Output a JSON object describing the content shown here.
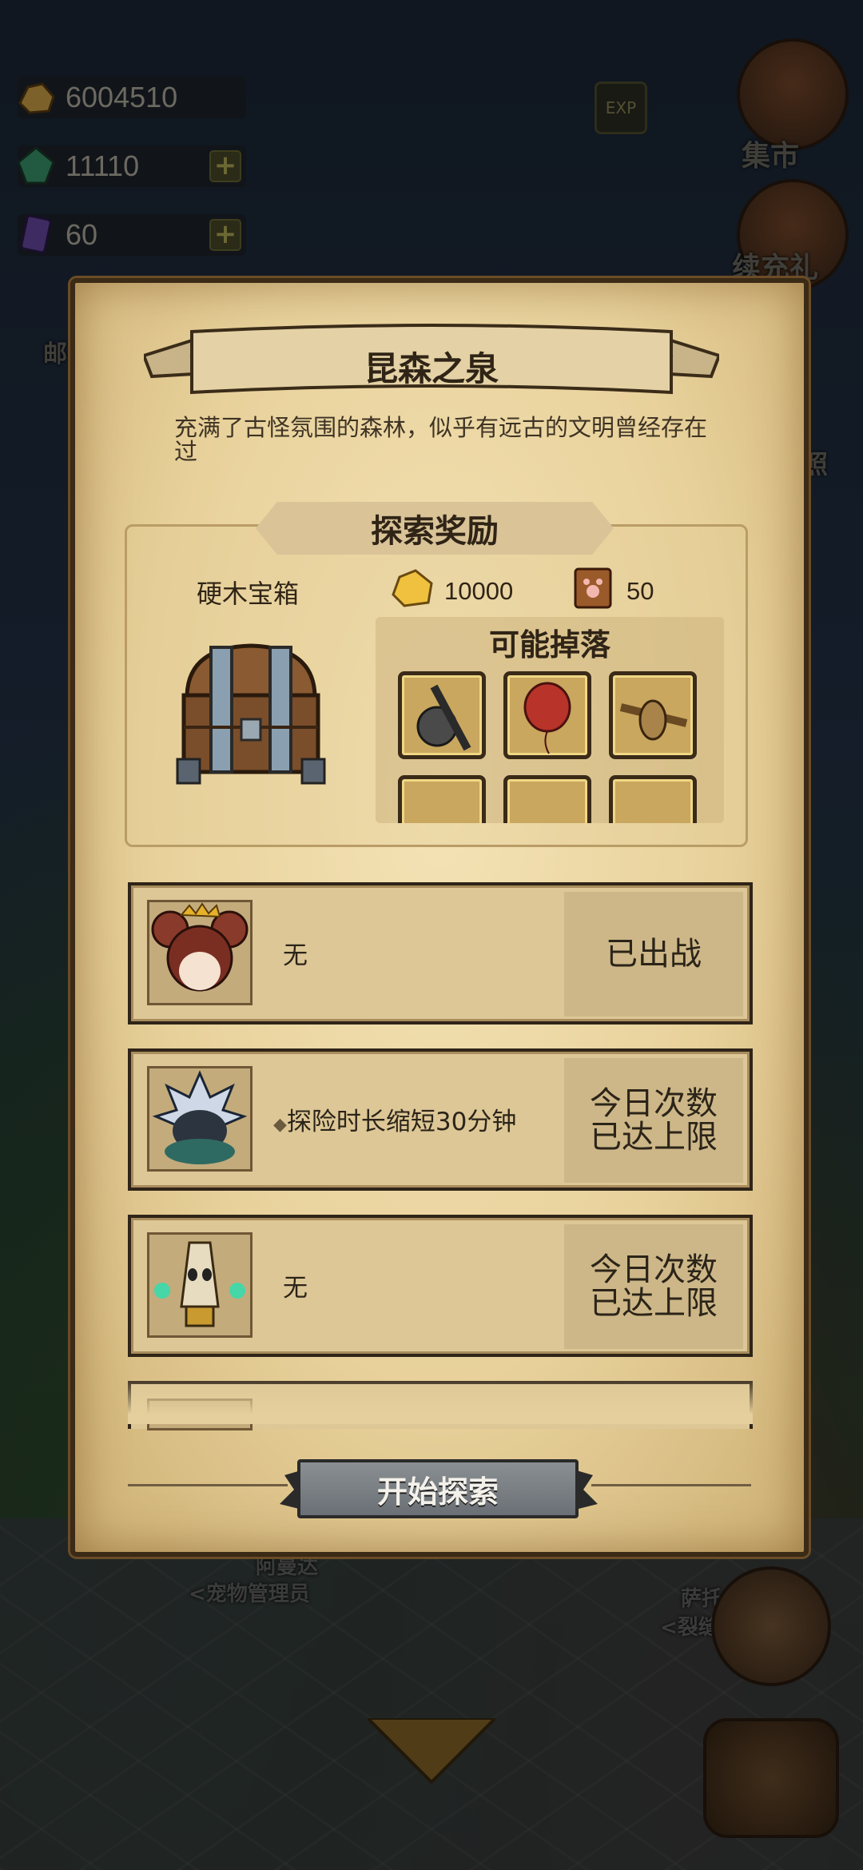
{
  "resources": {
    "gold": "6004510",
    "gems": "11110",
    "cards": "60"
  },
  "top_buttons": {
    "exp": "EXP",
    "market": "集市",
    "recharge": "续充礼"
  },
  "background_labels": {
    "mail": "邮",
    "photo": "照",
    "npc_left_name": "阿曼达",
    "npc_left_title": "<宠物管理员",
    "npc_right_name": "萨托",
    "npc_right_title": "<裂缝"
  },
  "panel": {
    "title": "昆森之泉",
    "description": "充满了古怪氛围的森林，似乎有远古的文明曾经存在过",
    "reward_header": "探索奖励",
    "chest_name": "硬木宝箱",
    "gold_amount": "10000",
    "book_amount": "50",
    "drops_title": "可能掉落",
    "drops": [
      "helmet-sword",
      "red-balloon",
      "scarecrow",
      "item-4",
      "item-5",
      "item-6"
    ]
  },
  "heroes": [
    {
      "skill": "无",
      "status": "已出战",
      "avatar": "mouse-girl-portrait"
    },
    {
      "skill": "探险时长缩短30分钟",
      "status": "今日次数\n已达上限",
      "avatar": "spiky-knight-portrait"
    },
    {
      "skill": "无",
      "status": "今日次数\n已达上限",
      "avatar": "ghost-mask-portrait"
    }
  ],
  "start_button": "开始探索",
  "colors": {
    "parchment": "#e8d19b",
    "ink": "#2f2416",
    "button_gray": "#7a8085"
  }
}
